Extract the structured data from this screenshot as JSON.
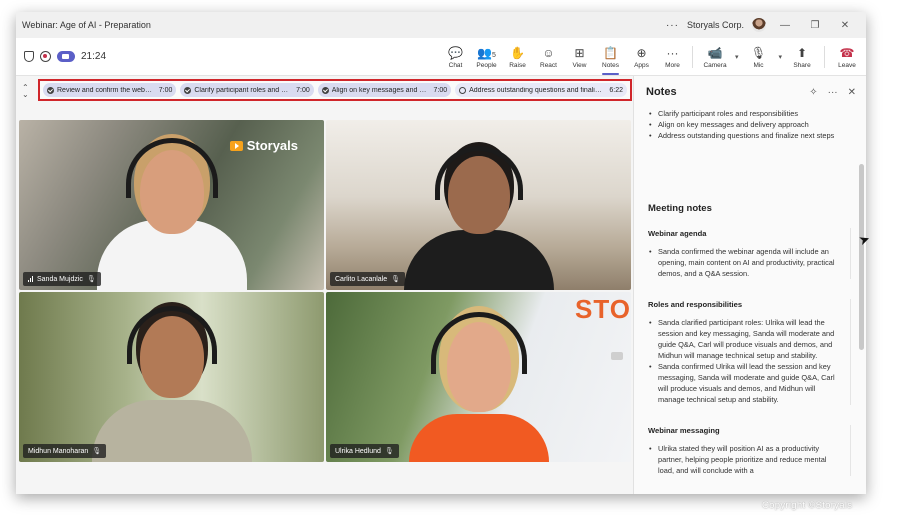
{
  "window": {
    "title": "Webinar: Age of AI - Preparation",
    "org": "Storyals Corp.",
    "more": "···",
    "minimize": "—",
    "restore": "❐",
    "close": "✕"
  },
  "toolbar": {
    "timer": "21:24",
    "people_count": "5",
    "tools": [
      {
        "label": "Chat",
        "glyph": "💬"
      },
      {
        "label": "People",
        "glyph": "👥"
      },
      {
        "label": "Raise",
        "glyph": "✋"
      },
      {
        "label": "React",
        "glyph": "☺"
      },
      {
        "label": "View",
        "glyph": "⊞"
      },
      {
        "label": "Notes",
        "glyph": "📋"
      },
      {
        "label": "Apps",
        "glyph": "⊕"
      },
      {
        "label": "More",
        "glyph": "···"
      }
    ],
    "media": [
      {
        "label": "Camera",
        "glyph": "📹"
      },
      {
        "label": "Mic",
        "glyph": "🎙"
      },
      {
        "label": "Share",
        "glyph": "⬆"
      }
    ],
    "leave_label": "Leave",
    "leave_glyph": "☎",
    "accent_color": "#5b5fc7",
    "leave_color": "#c4314b"
  },
  "agenda": {
    "items": [
      {
        "text": "Review and confirm the webin...",
        "time": "7:00",
        "done": true
      },
      {
        "text": "Clarify participant roles and re...",
        "time": "7:00",
        "done": true
      },
      {
        "text": "Align on key messages and de...",
        "time": "7:00",
        "done": true
      },
      {
        "text": "Address outstanding questions and finalize...",
        "time": "6:22",
        "done": false
      }
    ],
    "highlight_color": "#d0262b"
  },
  "participants": [
    {
      "name": "Sanda Mujdzic",
      "watermark": "Storyals"
    },
    {
      "name": "Carlito Lacanlale"
    },
    {
      "name": "Midhun Manoharan"
    },
    {
      "name": "Ulrika Hedlund",
      "wall_text": "STO"
    }
  ],
  "notes": {
    "title": "Notes",
    "agenda_list": [
      "Clarify participant roles and responsibilities",
      "Align on key messages and delivery approach",
      "Address outstanding questions and finalize next steps"
    ],
    "meeting_notes_title": "Meeting notes",
    "sections": [
      {
        "heading": "Webinar agenda",
        "bullets": [
          "Sanda confirmed the webinar agenda will include an opening, main content on AI and productivity, practical demos, and a Q&A session."
        ]
      },
      {
        "heading": "Roles and responsibilities",
        "bullets": [
          "Sanda clarified participant roles: Ulrika will lead the session and key messaging, Sanda will moderate and guide Q&A, Carl will produce visuals and demos, and Midhun will manage technical setup and stability.",
          "Sanda confirmed Ulrika will lead the session and key messaging, Sanda will moderate and guide Q&A, Carl will produce visuals and demos, and Midhun will manage technical setup and stability."
        ]
      },
      {
        "heading": "Webinar messaging",
        "bullets": [
          "Ulrika stated they will position AI as a productivity partner, helping people prioritize and reduce mental load, and will conclude with a"
        ]
      }
    ]
  },
  "copyright": "Copyright ©Storyals"
}
